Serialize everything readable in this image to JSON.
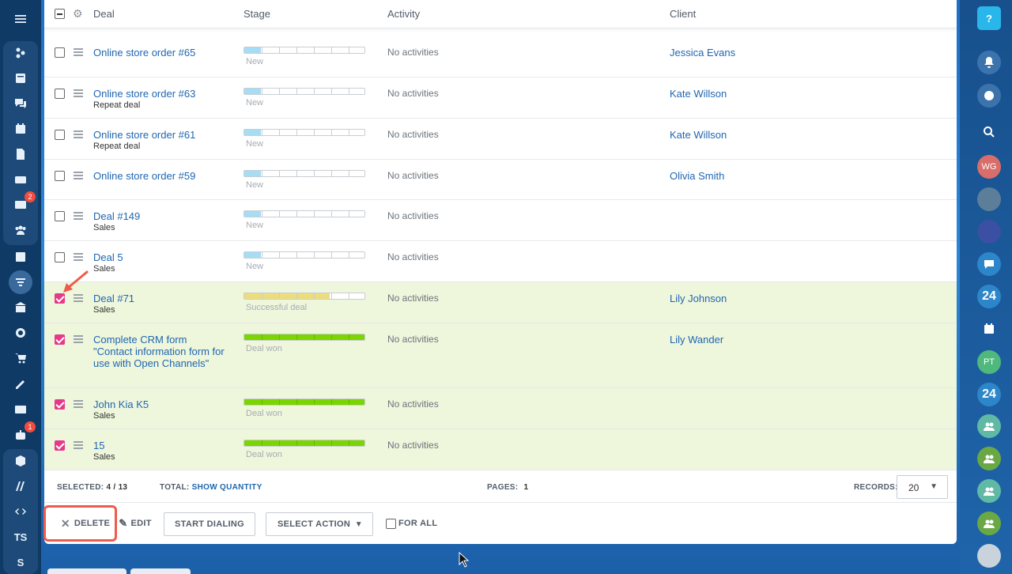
{
  "header": {
    "col_deal": "Deal",
    "col_stage": "Stage",
    "col_activity": "Activity",
    "col_client": "Client"
  },
  "rows": [
    {
      "title": "Online store order #65",
      "sub": "",
      "stage_label": "New",
      "stage_fill": 0.14,
      "stage_color": "#a7dcf5",
      "activity": "No activities",
      "client": "Jessica Evans",
      "checked": false
    },
    {
      "title": "Online store order #63",
      "sub": "Repeat deal",
      "stage_label": "New",
      "stage_fill": 0.14,
      "stage_color": "#a7dcf5",
      "activity": "No activities",
      "client": "Kate Willson",
      "checked": false
    },
    {
      "title": "Online store order #61",
      "sub": "Repeat deal",
      "stage_label": "New",
      "stage_fill": 0.14,
      "stage_color": "#a7dcf5",
      "activity": "No activities",
      "client": "Kate Willson",
      "checked": false
    },
    {
      "title": "Online store order #59",
      "sub": "",
      "stage_label": "New",
      "stage_fill": 0.14,
      "stage_color": "#a7dcf5",
      "activity": "No activities",
      "client": "Olivia Smith",
      "checked": false
    },
    {
      "title": "Deal #149",
      "sub": "Sales",
      "stage_label": "New",
      "stage_fill": 0.14,
      "stage_color": "#a7dcf5",
      "activity": "No activities",
      "client": "",
      "checked": false
    },
    {
      "title": "Deal 5",
      "sub": "Sales",
      "stage_label": "New",
      "stage_fill": 0.14,
      "stage_color": "#a7dcf5",
      "activity": "No activities",
      "client": "",
      "checked": false
    },
    {
      "title": "Deal #71",
      "sub": "Sales",
      "stage_label": "Successful deal",
      "stage_fill": 0.71,
      "stage_color": "#ecdc7c",
      "activity": "No activities",
      "client": "Lily Johnson",
      "checked": true
    },
    {
      "title": "Complete CRM form \"Contact information form for use with Open Channels\"",
      "sub": "",
      "stage_label": "Deal won",
      "stage_fill": 1.0,
      "stage_color": "#7bd500",
      "activity": "No activities",
      "client": "Lily Wander",
      "checked": true
    },
    {
      "title": "John Kia K5",
      "sub": "Sales",
      "stage_label": "Deal won",
      "stage_fill": 1.0,
      "stage_color": "#7bd500",
      "activity": "No activities",
      "client": "",
      "checked": true
    },
    {
      "title": "15",
      "sub": "Sales",
      "stage_label": "Deal won",
      "stage_fill": 1.0,
      "stage_color": "#7bd500",
      "activity": "No activities",
      "client": "",
      "checked": true
    }
  ],
  "footer": {
    "selected_label": "SELECTED:",
    "selected_value": "4 / 13",
    "total_label": "TOTAL:",
    "total_link": "SHOW QUANTITY",
    "pages_label": "PAGES:",
    "pages_value": "1",
    "records_label": "RECORDS:",
    "records_value": "20"
  },
  "actions": {
    "delete": "DELETE",
    "edit": "EDIT",
    "start_dialing": "START DIALING",
    "select_action": "SELECT ACTION",
    "for_all": "FOR ALL"
  },
  "left_sidebar": {
    "mail_badge": "2",
    "robot_badge": "1",
    "ts_label": "TS",
    "s_label": "S"
  },
  "right_sidebar": {
    "help": "?",
    "avatar_wg": "WG",
    "avatar_pt": "PT",
    "b24_1": "24",
    "b24_2": "24"
  },
  "colors": {
    "accent": "#2067b0",
    "check": "#e6398a",
    "selected_row": "#eef6dc",
    "highlight": "#ef5b4b"
  }
}
